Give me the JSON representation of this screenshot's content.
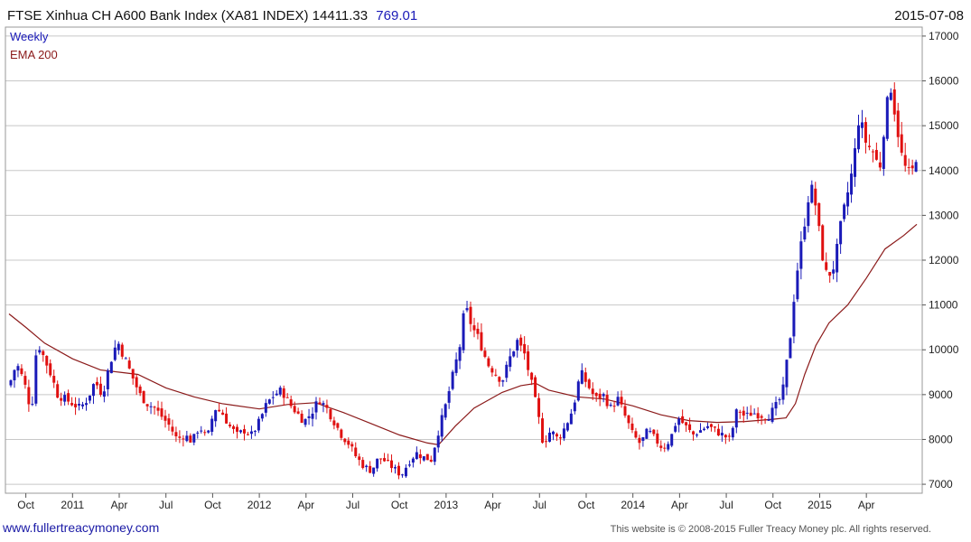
{
  "header": {
    "title": "FTSE Xinhua CH A600 Bank Index (XA81 INDEX) 14411.33",
    "change": "769.01",
    "date": "2015-07-08"
  },
  "legend": {
    "weekly": "Weekly",
    "ema": "EMA 200"
  },
  "footer": {
    "site": "www.fullertreacymoney.com",
    "copyright": "This website is © 2008-2015 Fuller Treacy Money plc. All rights reserved."
  },
  "colors": {
    "up": "#1a1ab8",
    "down": "#e01010",
    "ema": "#8b1a1a",
    "grid": "#c8c8c8",
    "title_value": "#1a1ab8",
    "legend_weekly": "#1a1ab8",
    "legend_ema": "#8b1a1a"
  },
  "chart_data": {
    "type": "candlestick",
    "interval": "weekly",
    "x_range": [
      2010.66,
      2015.52
    ],
    "ylim": [
      6800,
      17200
    ],
    "y_ticks": [
      7000,
      8000,
      9000,
      10000,
      11000,
      12000,
      13000,
      14000,
      15000,
      16000,
      17000
    ],
    "x_ticks": [
      {
        "label": "Oct",
        "t": 2010.75
      },
      {
        "label": "2011",
        "t": 2011.0
      },
      {
        "label": "Apr",
        "t": 2011.25
      },
      {
        "label": "Jul",
        "t": 2011.5
      },
      {
        "label": "Oct",
        "t": 2011.75
      },
      {
        "label": "2012",
        "t": 2012.0
      },
      {
        "label": "Apr",
        "t": 2012.25
      },
      {
        "label": "Jul",
        "t": 2012.5
      },
      {
        "label": "Oct",
        "t": 2012.75
      },
      {
        "label": "2013",
        "t": 2013.0
      },
      {
        "label": "Apr",
        "t": 2013.25
      },
      {
        "label": "Jul",
        "t": 2013.5
      },
      {
        "label": "Oct",
        "t": 2013.75
      },
      {
        "label": "2014",
        "t": 2014.0
      },
      {
        "label": "Apr",
        "t": 2014.25
      },
      {
        "label": "Jul",
        "t": 2014.5
      },
      {
        "label": "Oct",
        "t": 2014.75
      },
      {
        "label": "2015",
        "t": 2015.0
      },
      {
        "label": "Apr",
        "t": 2015.25
      }
    ],
    "close_path": [
      [
        2010.66,
        9200
      ],
      [
        2010.7,
        9700
      ],
      [
        2010.74,
        9300
      ],
      [
        2010.78,
        8600
      ],
      [
        2010.81,
        10200
      ],
      [
        2010.84,
        9900
      ],
      [
        2010.88,
        9500
      ],
      [
        2010.92,
        9000
      ],
      [
        2010.96,
        8900
      ],
      [
        2011.0,
        8800
      ],
      [
        2011.04,
        8700
      ],
      [
        2011.08,
        8900
      ],
      [
        2011.12,
        9300
      ],
      [
        2011.16,
        9000
      ],
      [
        2011.2,
        9700
      ],
      [
        2011.24,
        10200
      ],
      [
        2011.28,
        9800
      ],
      [
        2011.32,
        9400
      ],
      [
        2011.36,
        9000
      ],
      [
        2011.4,
        8800
      ],
      [
        2011.44,
        8700
      ],
      [
        2011.48,
        8500
      ],
      [
        2011.52,
        8300
      ],
      [
        2011.56,
        8000
      ],
      [
        2011.6,
        8100
      ],
      [
        2011.64,
        7950
      ],
      [
        2011.68,
        8300
      ],
      [
        2011.72,
        8000
      ],
      [
        2011.76,
        8700
      ],
      [
        2011.8,
        8600
      ],
      [
        2011.84,
        8300
      ],
      [
        2011.88,
        8100
      ],
      [
        2011.92,
        8200
      ],
      [
        2011.96,
        8100
      ],
      [
        2012.0,
        8400
      ],
      [
        2012.04,
        8800
      ],
      [
        2012.08,
        9000
      ],
      [
        2012.12,
        9100
      ],
      [
        2012.16,
        8800
      ],
      [
        2012.2,
        8600
      ],
      [
        2012.24,
        8400
      ],
      [
        2012.28,
        8600
      ],
      [
        2012.32,
        8900
      ],
      [
        2012.36,
        8700
      ],
      [
        2012.4,
        8400
      ],
      [
        2012.44,
        8100
      ],
      [
        2012.48,
        7900
      ],
      [
        2012.52,
        7600
      ],
      [
        2012.56,
        7400
      ],
      [
        2012.6,
        7300
      ],
      [
        2012.64,
        7600
      ],
      [
        2012.68,
        7500
      ],
      [
        2012.72,
        7350
      ],
      [
        2012.76,
        7200
      ],
      [
        2012.8,
        7500
      ],
      [
        2012.84,
        7700
      ],
      [
        2012.88,
        7600
      ],
      [
        2012.92,
        7550
      ],
      [
        2012.96,
        8200
      ],
      [
        2013.0,
        8800
      ],
      [
        2013.04,
        9500
      ],
      [
        2013.08,
        10200
      ],
      [
        2013.1,
        11000
      ],
      [
        2013.14,
        10500
      ],
      [
        2013.18,
        10200
      ],
      [
        2013.22,
        9700
      ],
      [
        2013.26,
        9500
      ],
      [
        2013.3,
        9300
      ],
      [
        2013.34,
        9800
      ],
      [
        2013.38,
        10200
      ],
      [
        2013.42,
        9900
      ],
      [
        2013.46,
        9200
      ],
      [
        2013.49,
        8600
      ],
      [
        2013.52,
        7900
      ],
      [
        2013.56,
        8200
      ],
      [
        2013.6,
        8000
      ],
      [
        2013.64,
        8300
      ],
      [
        2013.68,
        8700
      ],
      [
        2013.72,
        9500
      ],
      [
        2013.76,
        9200
      ],
      [
        2013.8,
        8900
      ],
      [
        2013.84,
        9000
      ],
      [
        2013.88,
        8700
      ],
      [
        2013.92,
        8900
      ],
      [
        2013.96,
        8500
      ],
      [
        2014.0,
        8100
      ],
      [
        2014.04,
        7900
      ],
      [
        2014.08,
        8200
      ],
      [
        2014.12,
        8000
      ],
      [
        2014.16,
        7800
      ],
      [
        2014.2,
        8000
      ],
      [
        2014.24,
        8500
      ],
      [
        2014.28,
        8300
      ],
      [
        2014.32,
        8100
      ],
      [
        2014.36,
        8200
      ],
      [
        2014.4,
        8300
      ],
      [
        2014.44,
        8200
      ],
      [
        2014.48,
        8100
      ],
      [
        2014.52,
        8000
      ],
      [
        2014.56,
        8700
      ],
      [
        2014.6,
        8500
      ],
      [
        2014.64,
        8600
      ],
      [
        2014.68,
        8550
      ],
      [
        2014.72,
        8500
      ],
      [
        2014.76,
        8700
      ],
      [
        2014.8,
        9000
      ],
      [
        2014.84,
        10200
      ],
      [
        2014.87,
        11500
      ],
      [
        2014.91,
        12600
      ],
      [
        2014.95,
        13700
      ],
      [
        2014.98,
        13200
      ],
      [
        2015.01,
        12200
      ],
      [
        2015.04,
        11600
      ],
      [
        2015.08,
        11900
      ],
      [
        2015.11,
        12700
      ],
      [
        2015.14,
        13300
      ],
      [
        2015.18,
        14100
      ],
      [
        2015.21,
        15200
      ],
      [
        2015.25,
        14600
      ],
      [
        2015.29,
        14400
      ],
      [
        2015.32,
        14000
      ],
      [
        2015.35,
        15200
      ],
      [
        2015.38,
        15900
      ],
      [
        2015.41,
        15100
      ],
      [
        2015.44,
        14300
      ],
      [
        2015.47,
        13900
      ],
      [
        2015.5,
        14000
      ],
      [
        2015.52,
        14411
      ]
    ],
    "ema_200": [
      [
        2010.66,
        10800
      ],
      [
        2010.75,
        10500
      ],
      [
        2010.85,
        10150
      ],
      [
        2011.0,
        9800
      ],
      [
        2011.15,
        9550
      ],
      [
        2011.25,
        9500
      ],
      [
        2011.35,
        9450
      ],
      [
        2011.5,
        9150
      ],
      [
        2011.65,
        8950
      ],
      [
        2011.8,
        8800
      ],
      [
        2012.0,
        8680
      ],
      [
        2012.15,
        8780
      ],
      [
        2012.3,
        8820
      ],
      [
        2012.45,
        8600
      ],
      [
        2012.6,
        8350
      ],
      [
        2012.75,
        8100
      ],
      [
        2012.9,
        7920
      ],
      [
        2012.96,
        7880
      ],
      [
        2013.05,
        8300
      ],
      [
        2013.15,
        8700
      ],
      [
        2013.3,
        9050
      ],
      [
        2013.4,
        9200
      ],
      [
        2013.48,
        9250
      ],
      [
        2013.55,
        9100
      ],
      [
        2013.7,
        8950
      ],
      [
        2013.85,
        8900
      ],
      [
        2014.0,
        8750
      ],
      [
        2014.15,
        8550
      ],
      [
        2014.3,
        8420
      ],
      [
        2014.45,
        8380
      ],
      [
        2014.6,
        8400
      ],
      [
        2014.75,
        8450
      ],
      [
        2014.82,
        8480
      ],
      [
        2014.87,
        8800
      ],
      [
        2014.92,
        9450
      ],
      [
        2014.98,
        10100
      ],
      [
        2015.05,
        10600
      ],
      [
        2015.15,
        11000
      ],
      [
        2015.25,
        11600
      ],
      [
        2015.35,
        12250
      ],
      [
        2015.45,
        12550
      ],
      [
        2015.52,
        12800
      ]
    ]
  }
}
